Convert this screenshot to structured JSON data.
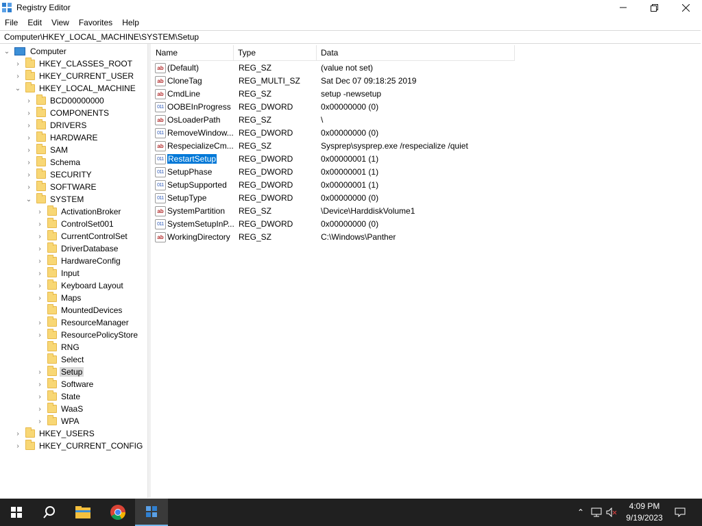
{
  "window": {
    "title": "Registry Editor",
    "controls": {
      "minimize": "minimize",
      "maximize": "restore",
      "close": "close"
    }
  },
  "menu": [
    "File",
    "Edit",
    "View",
    "Favorites",
    "Help"
  ],
  "address": "Computer\\HKEY_LOCAL_MACHINE\\SYSTEM\\Setup",
  "tree": {
    "root": "Computer",
    "hives": [
      "HKEY_CLASSES_ROOT",
      "HKEY_CURRENT_USER",
      "HKEY_LOCAL_MACHINE",
      "HKEY_USERS",
      "HKEY_CURRENT_CONFIG"
    ],
    "hklm_children": [
      "BCD00000000",
      "COMPONENTS",
      "DRIVERS",
      "HARDWARE",
      "SAM",
      "Schema",
      "SECURITY",
      "SOFTWARE",
      "SYSTEM"
    ],
    "system_children": [
      "ActivationBroker",
      "ControlSet001",
      "CurrentControlSet",
      "DriverDatabase",
      "HardwareConfig",
      "Input",
      "Keyboard Layout",
      "Maps",
      "MountedDevices",
      "ResourceManager",
      "ResourcePolicyStore",
      "RNG",
      "Select",
      "Setup",
      "Software",
      "State",
      "WaaS",
      "WPA"
    ],
    "selected": "Setup"
  },
  "columns": {
    "name": "Name",
    "type": "Type",
    "data": "Data"
  },
  "values": [
    {
      "name": "(Default)",
      "type": "REG_SZ",
      "data": "(value not set)",
      "icon": "string-icon"
    },
    {
      "name": "CloneTag",
      "type": "REG_MULTI_SZ",
      "data": "Sat Dec 07 09:18:25 2019",
      "icon": "string-icon"
    },
    {
      "name": "CmdLine",
      "type": "REG_SZ",
      "data": "setup -newsetup",
      "icon": "string-icon"
    },
    {
      "name": "OOBEInProgress",
      "type": "REG_DWORD",
      "data": "0x00000000 (0)",
      "icon": "binary-icon"
    },
    {
      "name": "OsLoaderPath",
      "type": "REG_SZ",
      "data": "\\",
      "icon": "string-icon"
    },
    {
      "name": "RemoveWindow...",
      "type": "REG_DWORD",
      "data": "0x00000000 (0)",
      "icon": "binary-icon"
    },
    {
      "name": "RespecializeCm...",
      "type": "REG_SZ",
      "data": "Sysprep\\sysprep.exe /respecialize /quiet",
      "icon": "string-icon"
    },
    {
      "name": "RestartSetup",
      "type": "REG_DWORD",
      "data": "0x00000001 (1)",
      "icon": "binary-icon",
      "selected": true
    },
    {
      "name": "SetupPhase",
      "type": "REG_DWORD",
      "data": "0x00000001 (1)",
      "icon": "binary-icon"
    },
    {
      "name": "SetupSupported",
      "type": "REG_DWORD",
      "data": "0x00000001 (1)",
      "icon": "binary-icon"
    },
    {
      "name": "SetupType",
      "type": "REG_DWORD",
      "data": "0x00000000 (0)",
      "icon": "binary-icon"
    },
    {
      "name": "SystemPartition",
      "type": "REG_SZ",
      "data": "\\Device\\HarddiskVolume1",
      "icon": "string-icon"
    },
    {
      "name": "SystemSetupInP...",
      "type": "REG_DWORD",
      "data": "0x00000000 (0)",
      "icon": "binary-icon"
    },
    {
      "name": "WorkingDirectory",
      "type": "REG_SZ",
      "data": "C:\\Windows\\Panther",
      "icon": "string-icon"
    }
  ],
  "taskbar": {
    "apps": [
      "start-icon",
      "search-icon",
      "file-explorer-icon",
      "chrome-icon",
      "registry-editor-icon"
    ],
    "time": "4:09 PM",
    "date": "9/19/2023"
  }
}
